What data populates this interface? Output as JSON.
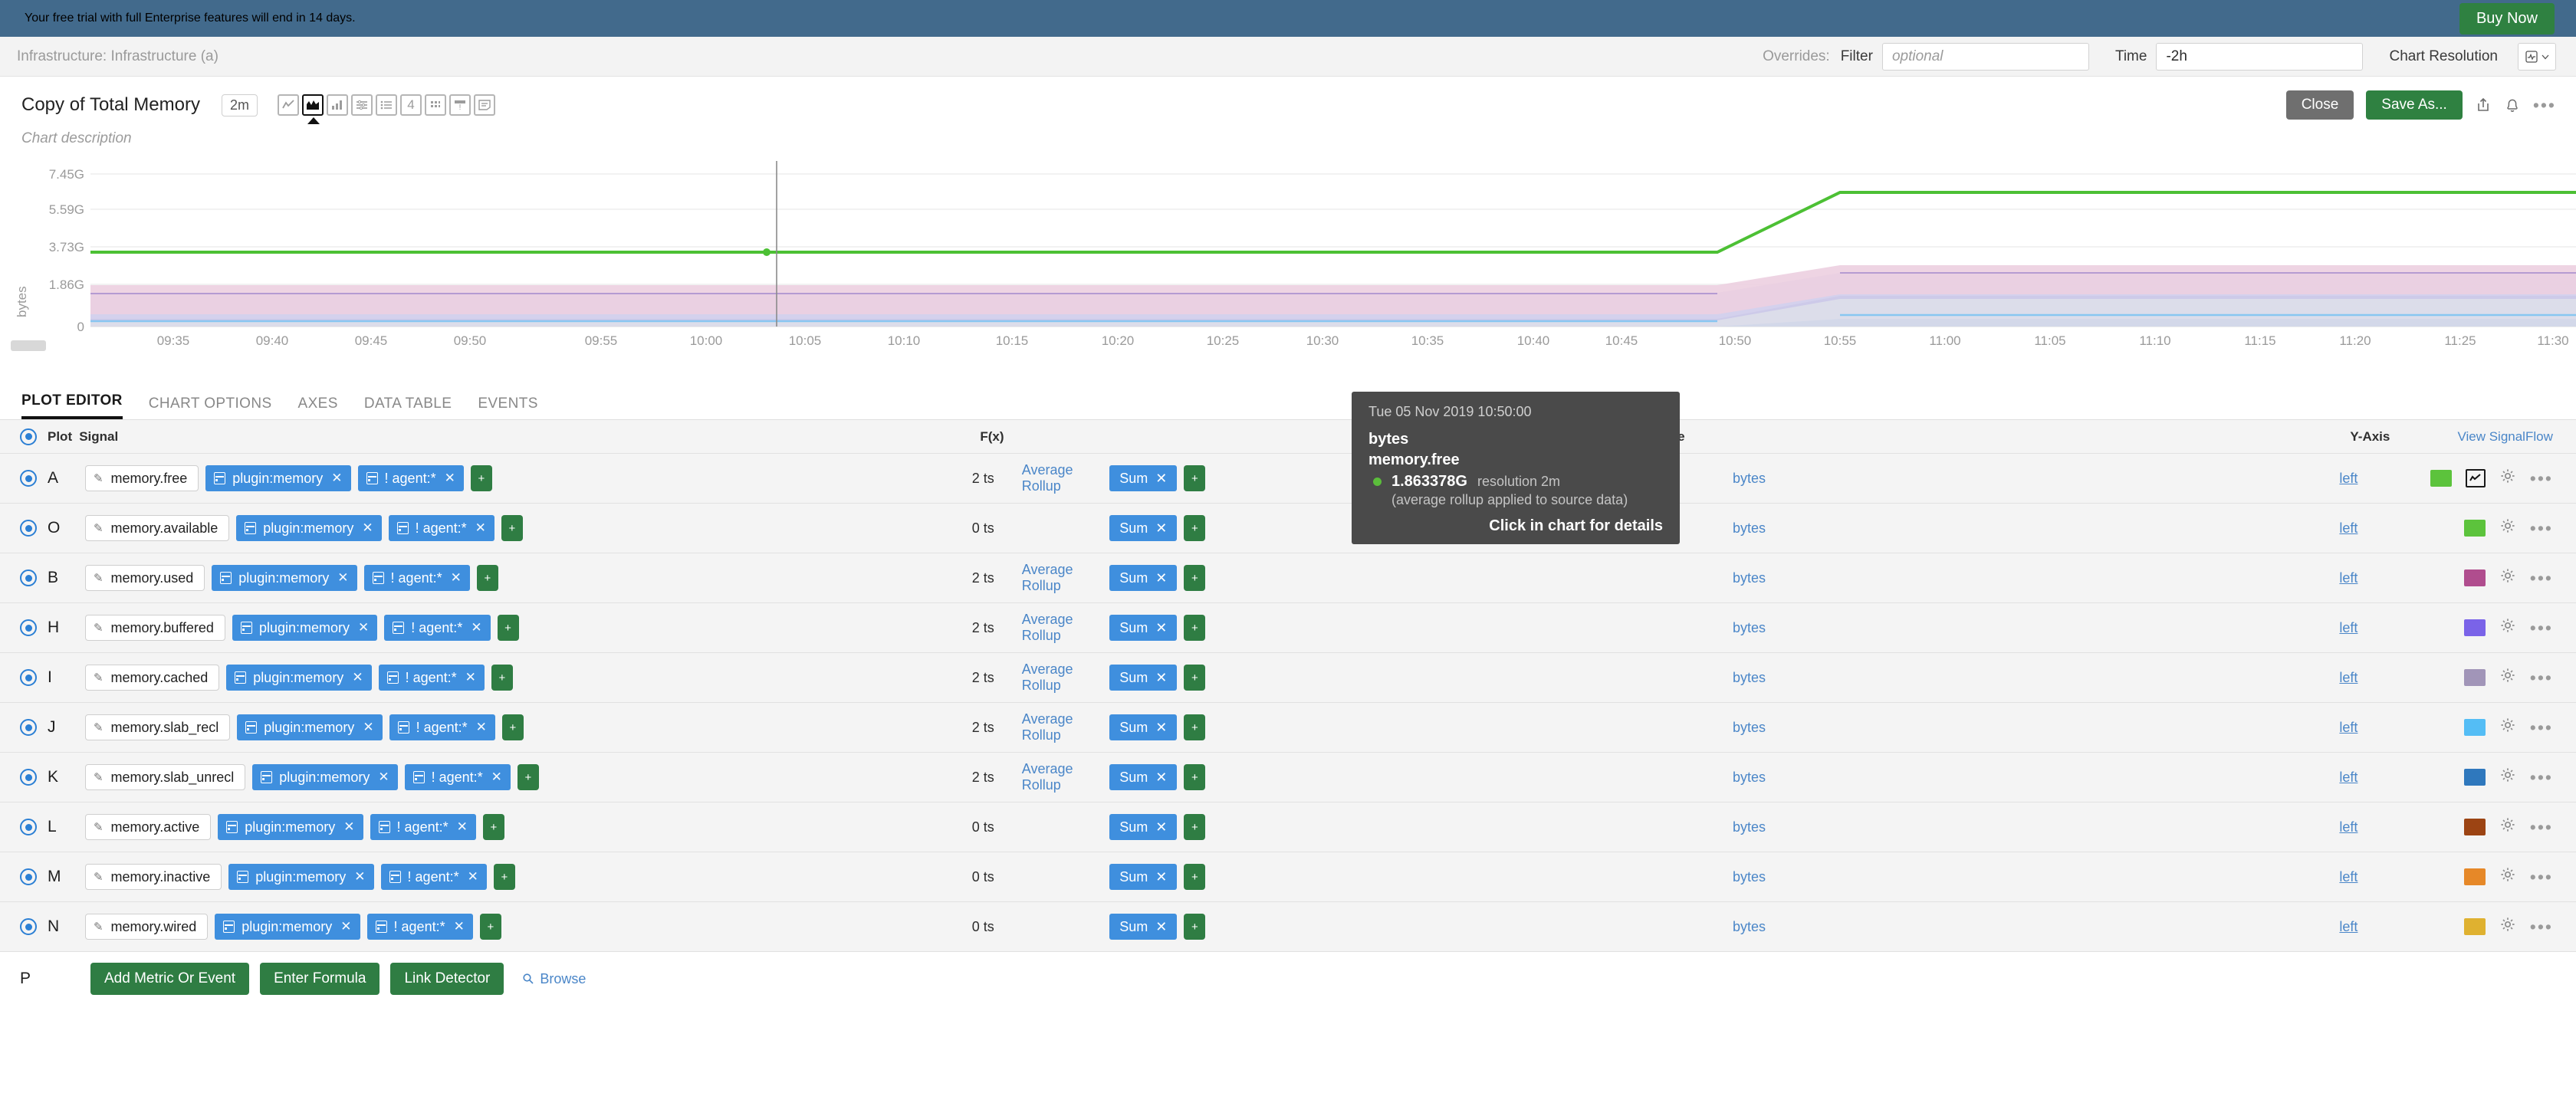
{
  "banner": {
    "message": "Your free trial with full Enterprise features will end in 14 days.",
    "cta": "Buy Now"
  },
  "subbar": {
    "breadcrumb": "Infrastructure: Infrastructure (a)",
    "overrides_label": "Overrides:",
    "filter_label": "Filter",
    "filter_value": "",
    "filter_placeholder": "optional",
    "time_label": "Time",
    "time_value": "-2h",
    "chart_resolution_label": "Chart Resolution"
  },
  "chart_header": {
    "title": "Copy of Total Memory",
    "resolution_pill": "2m",
    "description": "Chart description",
    "close_label": "Close",
    "save_as_label": "Save As...",
    "viz_icons": [
      "line-chart-icon",
      "area-chart-icon",
      "column-chart-icon",
      "heatmap-icon",
      "list-icon",
      "single-value-icon",
      "table-icon",
      "event-icon",
      "text-note-icon"
    ],
    "viz_selected_index": 1
  },
  "tooltip": {
    "timestamp": "Tue 05 Nov 2019 10:50:00",
    "unit": "bytes",
    "metric": "memory.free",
    "value": "1.863378G",
    "resolution": "resolution 2m",
    "note": "(average rollup applied to source data)",
    "hint": "Click in chart for details",
    "dot_color": "#5bbd3b"
  },
  "chart_data": {
    "type": "area",
    "title": "Copy of Total Memory",
    "xlabel": "",
    "ylabel": "bytes",
    "ylim": [
      0,
      8200000000
    ],
    "ytick_labels": [
      "7.45G",
      "5.59G",
      "3.73G",
      "1.86G",
      "0"
    ],
    "ytick_values": [
      7450000000,
      5590000000,
      3730000000,
      1860000000,
      0
    ],
    "xtick_labels": [
      "09:35",
      "09:40",
      "09:45",
      "09:50",
      "09:55",
      "10:00",
      "10:05",
      "10:10",
      "10:15",
      "10:20",
      "10:25",
      "10:30",
      "10:35",
      "10:40",
      "10:45",
      "10:50",
      "10:55",
      "11:00",
      "11:05",
      "11:10",
      "11:15",
      "11:20",
      "11:25",
      "11:30"
    ],
    "grid": true,
    "legend": "none",
    "cursor_time": "10:50",
    "series": [
      {
        "name": "memory.free",
        "color": "#4cc034",
        "type": "line",
        "x": [
          "09:32",
          "10:45",
          "11:20",
          "11:30"
        ],
        "values": [
          1863378000,
          1863378000,
          6050000000,
          6050000000
        ]
      },
      {
        "name": "memory.used",
        "color": "#b0578f",
        "type": "area",
        "x": [
          "09:32",
          "10:45",
          "11:20",
          "11:30"
        ],
        "values": [
          1240000000,
          1240000000,
          1900000000,
          1900000000
        ]
      },
      {
        "name": "memory.buffered",
        "color": "#7b68e0",
        "type": "area",
        "x": [
          "09:32",
          "10:45",
          "11:20",
          "11:30"
        ],
        "values": [
          1080000000,
          1080000000,
          1660000000,
          1660000000
        ]
      },
      {
        "name": "memory.cached",
        "color": "#a294bd",
        "type": "area",
        "x": [
          "09:32",
          "10:45",
          "11:20",
          "11:30"
        ],
        "values": [
          1050000000,
          1050000000,
          1620000000,
          1620000000
        ]
      },
      {
        "name": "memory.slab_recl",
        "color": "#57bdf7",
        "type": "area",
        "x": [
          "09:32",
          "10:45",
          "11:20",
          "11:30"
        ],
        "values": [
          150000000,
          150000000,
          190000000,
          190000000
        ]
      }
    ]
  },
  "tabs": [
    {
      "label": "PLOT EDITOR",
      "active": true
    },
    {
      "label": "CHART OPTIONS",
      "active": false
    },
    {
      "label": "AXES",
      "active": false
    },
    {
      "label": "DATA TABLE",
      "active": false
    },
    {
      "label": "EVENTS",
      "active": false
    }
  ],
  "table": {
    "headers": {
      "plot": "Plot",
      "signal": "Signal",
      "fx": "F(x)",
      "name": "Name",
      "yaxis": "Y-Axis",
      "signalflow": "View SignalFlow"
    },
    "rows": [
      {
        "letter": "A",
        "signal": "memory.free",
        "filters": [
          "plugin:memory",
          "! agent:*"
        ],
        "ts": "2 ts",
        "fx": "Average Rollup",
        "agg": "Sum",
        "name": "bytes",
        "yaxis": "left",
        "color": "#5cc33c",
        "has_viz": true
      },
      {
        "letter": "O",
        "signal": "memory.available",
        "filters": [
          "plugin:memory",
          "! agent:*"
        ],
        "ts": "0 ts",
        "fx": "",
        "agg": "Sum",
        "name": "bytes",
        "yaxis": "left",
        "color": "#5cc33c",
        "has_viz": false
      },
      {
        "letter": "B",
        "signal": "memory.used",
        "filters": [
          "plugin:memory",
          "! agent:*"
        ],
        "ts": "2 ts",
        "fx": "Average Rollup",
        "agg": "Sum",
        "name": "bytes",
        "yaxis": "left",
        "color": "#b04d8e",
        "has_viz": false
      },
      {
        "letter": "H",
        "signal": "memory.buffered",
        "filters": [
          "plugin:memory",
          "! agent:*"
        ],
        "ts": "2 ts",
        "fx": "Average Rollup",
        "agg": "Sum",
        "name": "bytes",
        "yaxis": "left",
        "color": "#7a63e8",
        "has_viz": false
      },
      {
        "letter": "I",
        "signal": "memory.cached",
        "filters": [
          "plugin:memory",
          "! agent:*"
        ],
        "ts": "2 ts",
        "fx": "Average Rollup",
        "agg": "Sum",
        "name": "bytes",
        "yaxis": "left",
        "color": "#a195b8",
        "has_viz": false
      },
      {
        "letter": "J",
        "signal": "memory.slab_recl",
        "filters": [
          "plugin:memory",
          "! agent:*"
        ],
        "ts": "2 ts",
        "fx": "Average Rollup",
        "agg": "Sum",
        "name": "bytes",
        "yaxis": "left",
        "color": "#54bdf5",
        "has_viz": false
      },
      {
        "letter": "K",
        "signal": "memory.slab_unrecl",
        "filters": [
          "plugin:memory",
          "! agent:*"
        ],
        "ts": "2 ts",
        "fx": "Average Rollup",
        "agg": "Sum",
        "name": "bytes",
        "yaxis": "left",
        "color": "#2f78bd",
        "has_viz": false
      },
      {
        "letter": "L",
        "signal": "memory.active",
        "filters": [
          "plugin:memory",
          "! agent:*"
        ],
        "ts": "0 ts",
        "fx": "",
        "agg": "Sum",
        "name": "bytes",
        "yaxis": "left",
        "color": "#9c4413",
        "has_viz": false
      },
      {
        "letter": "M",
        "signal": "memory.inactive",
        "filters": [
          "plugin:memory",
          "! agent:*"
        ],
        "ts": "0 ts",
        "fx": "",
        "agg": "Sum",
        "name": "bytes",
        "yaxis": "left",
        "color": "#e68828",
        "has_viz": false
      },
      {
        "letter": "N",
        "signal": "memory.wired",
        "filters": [
          "plugin:memory",
          "! agent:*"
        ],
        "ts": "0 ts",
        "fx": "",
        "agg": "Sum",
        "name": "bytes",
        "yaxis": "left",
        "color": "#dfb130",
        "has_viz": false
      }
    ],
    "footer": {
      "letter": "P",
      "add_metric": "Add Metric Or Event",
      "enter_formula": "Enter Formula",
      "link_detector": "Link Detector",
      "browse": "Browse"
    }
  }
}
